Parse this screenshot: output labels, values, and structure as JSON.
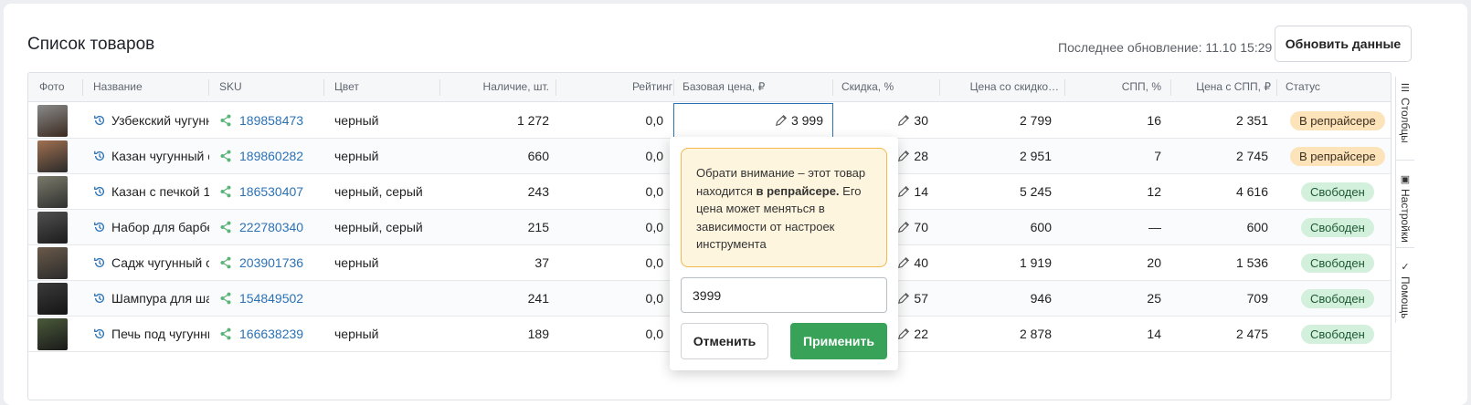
{
  "header": {
    "title": "Список товаров",
    "last_update": "Последнее обновление: 11.10 15:29",
    "refresh_label": "Обновить данные"
  },
  "columns": [
    "Фото",
    "Название",
    "SKU",
    "Цвет",
    "Наличие, шт.",
    "Рейтинг",
    "Базовая цена, ₽",
    "Скидка, %",
    "Цена со скидко…",
    "СПП, %",
    "Цена с СПП, ₽",
    "Статус"
  ],
  "rows": [
    {
      "name": "Узбекский чугунный",
      "sku": "189858473",
      "color": "черный",
      "stock": "1 272",
      "rating": "0,0",
      "base_price": "3 999",
      "discount": "30",
      "discounted": "2 799",
      "spp": "16",
      "spp_price": "2 351",
      "status": "В репрайсере",
      "status_type": "warn"
    },
    {
      "name": "Казан чугунный с",
      "sku": "189860282",
      "color": "черный",
      "stock": "660",
      "rating": "0,0",
      "base_price": "",
      "discount": "28",
      "discounted": "2 951",
      "spp": "7",
      "spp_price": "2 745",
      "status": "В репрайсере",
      "status_type": "warn"
    },
    {
      "name": "Казан с печкой 1",
      "sku": "186530407",
      "color": "черный, серый",
      "stock": "243",
      "rating": "0,0",
      "base_price": "",
      "discount": "14",
      "discounted": "5 245",
      "spp": "12",
      "spp_price": "4 616",
      "status": "Свободен",
      "status_type": "ok"
    },
    {
      "name": "Набор для барбе",
      "sku": "222780340",
      "color": "черный, серый",
      "stock": "215",
      "rating": "0,0",
      "base_price": "",
      "discount": "70",
      "discounted": "600",
      "spp": "—",
      "spp_price": "600",
      "status": "Свободен",
      "status_type": "ok"
    },
    {
      "name": "Садж чугунный с",
      "sku": "203901736",
      "color": "черный",
      "stock": "37",
      "rating": "0,0",
      "base_price": "",
      "discount": "40",
      "discounted": "1 919",
      "spp": "20",
      "spp_price": "1 536",
      "status": "Свободен",
      "status_type": "ok"
    },
    {
      "name": "Шампура для ша",
      "sku": "154849502",
      "color": "",
      "stock": "241",
      "rating": "0,0",
      "base_price": "",
      "discount": "57",
      "discounted": "946",
      "spp": "25",
      "spp_price": "709",
      "status": "Свободен",
      "status_type": "ok"
    },
    {
      "name": "Печь под чугунны",
      "sku": "166638239",
      "color": "черный",
      "stock": "189",
      "rating": "0,0",
      "base_price": "",
      "discount": "22",
      "discounted": "2 878",
      "spp": "14",
      "spp_price": "2 475",
      "status": "Свободен",
      "status_type": "ok"
    }
  ],
  "popup": {
    "notice_pre": "Обрати внимание – этот товар находится ",
    "notice_bold": "в репрайсере.",
    "notice_post": " Его цена может меняться в зависимости от настроек инструмента",
    "input_value": "3999",
    "cancel_label": "Отменить",
    "apply_label": "Применить"
  },
  "side_tabs": [
    "Столбцы",
    "Настройки",
    "Помощь"
  ],
  "icons": {
    "history": "history-icon",
    "share": "share-icon",
    "edit": "pencil-icon"
  },
  "colors": {
    "link": "#2b72b5",
    "warn_badge": "#fde3ba",
    "ok_badge": "#d3f0dc",
    "apply": "#37a258",
    "notice_border": "#f2b84b"
  }
}
